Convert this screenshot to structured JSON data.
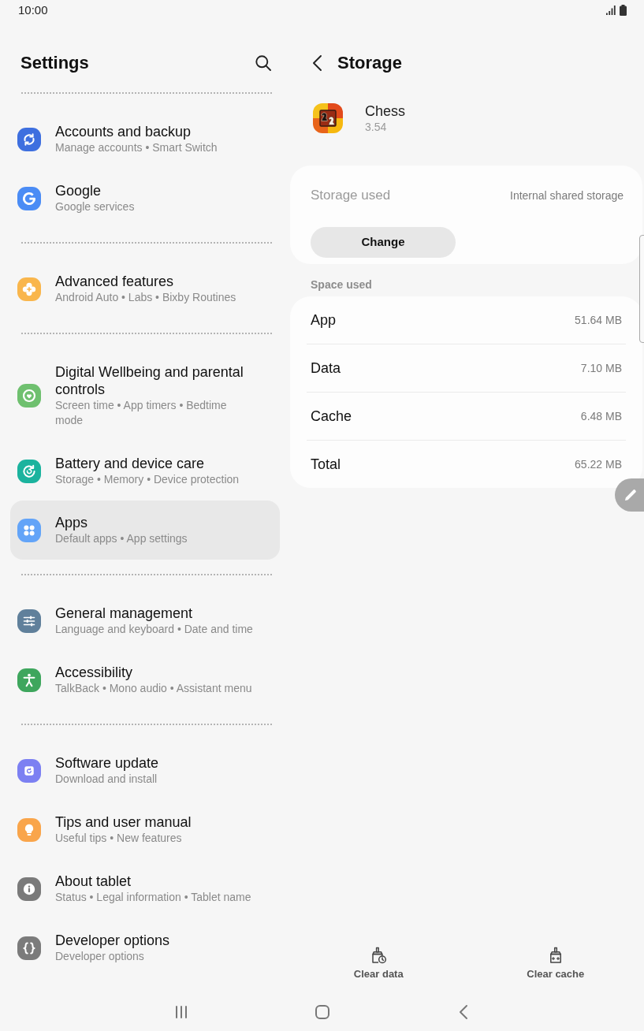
{
  "status_bar": {
    "time": "10:00"
  },
  "settings": {
    "title": "Settings",
    "groups": [
      {
        "items": [
          {
            "title": "Accounts and backup",
            "subtitle": "Manage accounts • Smart Switch",
            "color": "#3e6fdf",
            "selected": false
          },
          {
            "title": "Google",
            "subtitle": "Google services",
            "color": "#4b8cf5",
            "selected": false
          }
        ]
      },
      {
        "items": [
          {
            "title": "Advanced features",
            "subtitle": "Android Auto • Labs • Bixby Routines",
            "color": "#f9b64c",
            "selected": false
          }
        ]
      },
      {
        "items": [
          {
            "title": "Digital Wellbeing and parental controls",
            "subtitle": "Screen time • App timers • Bedtime mode",
            "color": "#6fc06f",
            "selected": false
          },
          {
            "title": "Battery and device care",
            "subtitle": "Storage • Memory • Device protection",
            "color": "#1bb39e",
            "selected": false
          },
          {
            "title": "Apps",
            "subtitle": "Default apps • App settings",
            "color": "#63a4f8",
            "selected": true
          }
        ]
      },
      {
        "items": [
          {
            "title": "General management",
            "subtitle": "Language and keyboard • Date and time",
            "color": "#60809b",
            "selected": false
          },
          {
            "title": "Accessibility",
            "subtitle": "TalkBack • Mono audio • Assistant menu",
            "color": "#3ea65d",
            "selected": false
          }
        ]
      },
      {
        "items": [
          {
            "title": "Software update",
            "subtitle": "Download and install",
            "color": "#7c80f2",
            "selected": false
          },
          {
            "title": "Tips and user manual",
            "subtitle": "Useful tips • New features",
            "color": "#f9a54b",
            "selected": false
          },
          {
            "title": "About tablet",
            "subtitle": "Status • Legal information • Tablet name",
            "color": "#7a7a7a",
            "selected": false
          },
          {
            "title": "Developer options",
            "subtitle": "Developer options",
            "color": "#7b7b7b",
            "selected": false
          }
        ]
      }
    ]
  },
  "storage": {
    "title": "Storage",
    "app": {
      "name": "Chess",
      "version": "3.54"
    },
    "location_card": {
      "label": "Storage used",
      "value": "Internal shared storage",
      "button": "Change"
    },
    "space_used": {
      "heading": "Space used",
      "rows": [
        {
          "label": "App",
          "value": "51.64 MB"
        },
        {
          "label": "Data",
          "value": "7.10 MB"
        },
        {
          "label": "Cache",
          "value": "6.48 MB"
        },
        {
          "label": "Total",
          "value": "65.22 MB"
        }
      ]
    },
    "actions": [
      {
        "label": "Clear data"
      },
      {
        "label": "Clear cache"
      }
    ]
  }
}
